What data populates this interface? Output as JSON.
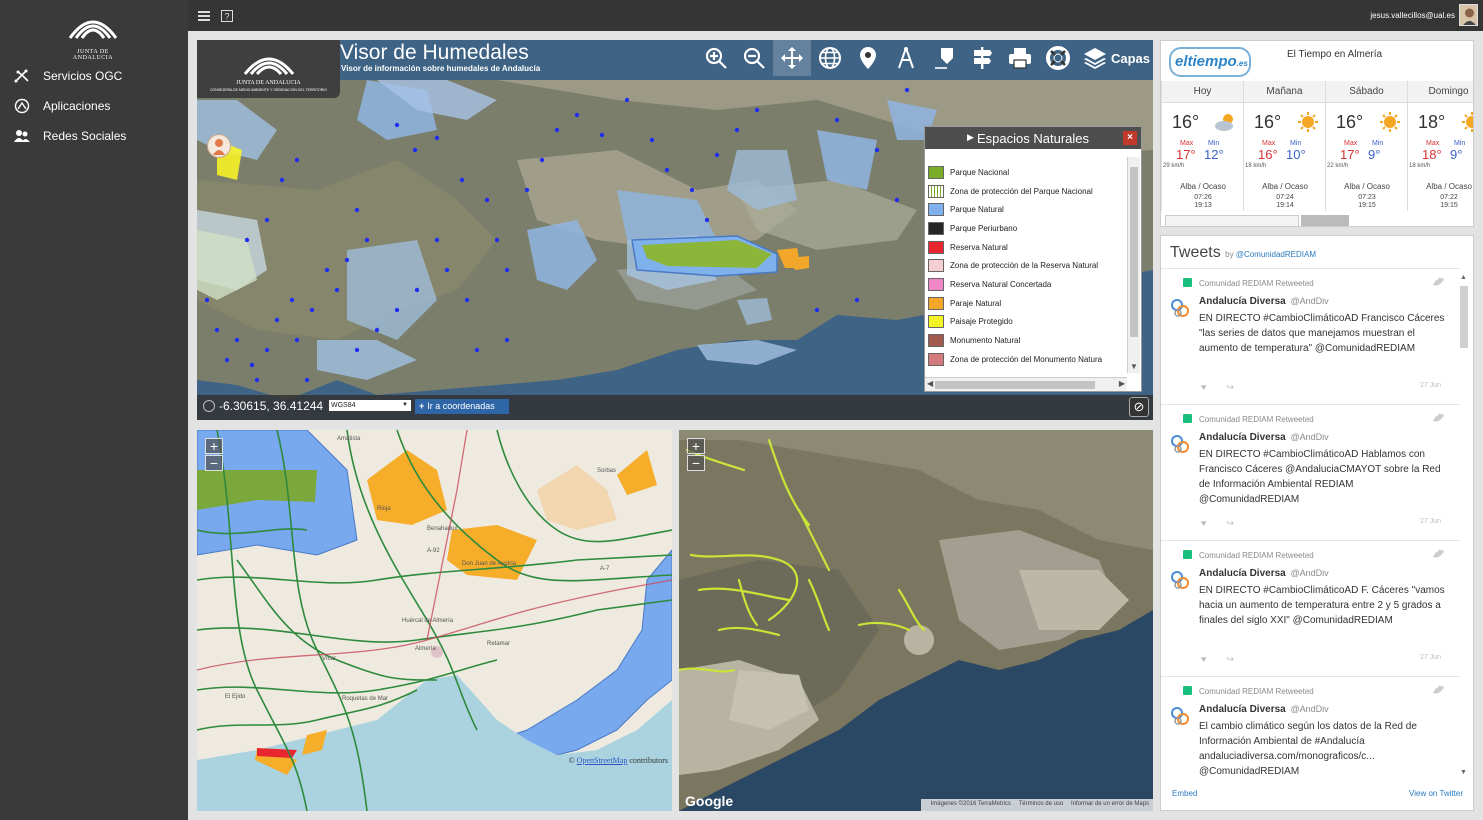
{
  "sidebar": {
    "logo_caption": "JUNTA DE ANDALUCIA",
    "items": [
      {
        "label": "Servicios OGC",
        "icon": "network-icon"
      },
      {
        "label": "Aplicaciones",
        "icon": "apps-icon"
      },
      {
        "label": "Redes Sociales",
        "icon": "people-icon"
      }
    ]
  },
  "topbar": {
    "menu_icon": "menu-icon",
    "help_icon": "help-icon",
    "user_email": "jesus.vallecillos@ual.es"
  },
  "viewer": {
    "logo_caption": "JUNTA DE ANDALUCIA",
    "logo_subcaption": "CONSEJERÍA DE MEDIO AMBIENTE Y ORDENACIÓN DEL TERRITORIO",
    "title": "Visor de Humedales",
    "subtitle": "Visor de información sobre humedales de Andalucía",
    "tools": [
      "zoom-in-icon",
      "zoom-out-icon",
      "pan-icon",
      "globe-icon",
      "location-pin-icon",
      "measure-icon",
      "draw-icon",
      "signpost-icon",
      "print-icon",
      "help-lifebuoy-icon",
      "layers-icon"
    ],
    "active_tool": "pan-icon",
    "capas_label": "Capas",
    "coords": {
      "value": "-6.30615, 36.41244",
      "crs": "WGS84",
      "goto_label": "Ir a coordenadas"
    }
  },
  "legend": {
    "title": "Espacios Naturales",
    "items": [
      {
        "label": "Parque Nacional",
        "color": "#7aac2a"
      },
      {
        "label": "Zona de protección del Parque Nacional",
        "color": "#ffffff"
      },
      {
        "label": "Parque Natural",
        "color": "#7fb2ec"
      },
      {
        "label": "Parque Periurbano",
        "color": "#262626"
      },
      {
        "label": "Reserva Natural",
        "color": "#e8262f"
      },
      {
        "label": "Zona de protección de la Reserva Natural",
        "color": "#f5cfd0"
      },
      {
        "label": "Reserva Natural Concertada",
        "color": "#ef87c6"
      },
      {
        "label": "Paraje Natural",
        "color": "#f2a72a"
      },
      {
        "label": "Paisaje Protegido",
        "color": "#f6f228"
      },
      {
        "label": "Monumento Natural",
        "color": "#a05a4e"
      },
      {
        "label": "Zona de protección del Monumento Natura",
        "color": "#d4797d"
      }
    ]
  },
  "map_osm": {
    "attribution_prefix": "©",
    "attribution_link": "OpenStreetMap",
    "attribution_suffix": "contributors",
    "places": [
      "Amatista",
      "Sorbas",
      "Huércal de Almería",
      "Almería",
      "Vícar",
      "El Ejido",
      "Roquetas de Mar",
      "Don Juan de Austria",
      "Retamar",
      "A-7",
      "A-92",
      "Rioja",
      "Benahadux"
    ]
  },
  "map_google": {
    "logo": "Google",
    "attr_imagery": "Imágenes ©2016 TerraMetrics",
    "attr_terms": "Términos de uso",
    "attr_report": "Informar de un error de Maps"
  },
  "weather": {
    "logo": "eltiempo",
    "logo_suffix": ".es",
    "title": "El Tiempo en Almería",
    "days": [
      {
        "name": "Hoy",
        "temp": "16°",
        "max_label": "Max",
        "max": "17°",
        "min_label": "Min",
        "min": "12°",
        "wind": "29 km/h",
        "sun_label": "Alba / Ocaso",
        "sunrise": "07:26",
        "sunset": "19:13",
        "icon": "cloudy-sun-icon"
      },
      {
        "name": "Mañana",
        "temp": "16°",
        "max_label": "Max",
        "max": "16°",
        "min_label": "Min",
        "min": "10°",
        "wind": "18 km/h",
        "sun_label": "Alba / Ocaso",
        "sunrise": "07:24",
        "sunset": "19:14",
        "icon": "sun-icon"
      },
      {
        "name": "Sábado",
        "temp": "16°",
        "max_label": "Max",
        "max": "17°",
        "min_label": "Min",
        "min": "9°",
        "wind": "22 km/h",
        "sun_label": "Alba / Ocaso",
        "sunrise": "07:23",
        "sunset": "19:15",
        "icon": "sun-icon"
      },
      {
        "name": "Domingo",
        "temp": "18°",
        "max_label": "Max",
        "max": "18°",
        "min_label": "Min",
        "min": "9°",
        "wind": "18 km/h",
        "sun_label": "Alba / Ocaso",
        "sunrise": "07:22",
        "sunset": "19:15",
        "icon": "sun-icon"
      }
    ]
  },
  "tweets": {
    "title": "Tweets",
    "by_prefix": "by",
    "by_account": "@ComunidadREDIAM",
    "items": [
      {
        "retweet": "Comunidad REDIAM Retweeted",
        "name": "Andalucía Diversa",
        "handle": "@AndDiv",
        "text": "EN DIRECTO #CambioClimáticoAD Francisco Cáceres \"las series de datos que manejamos muestran el aumento de temperatura\" @ComunidadREDIAM",
        "date": "27 Jun"
      },
      {
        "retweet": "Comunidad REDIAM Retweeted",
        "name": "Andalucía Diversa",
        "handle": "@AndDiv",
        "text": "EN DIRECTO #CambioClimáticoAD Hablamos con Francisco Cáceres @AndaluciaCMAYOT sobre la Red de Información Ambiental REDIAM @ComunidadREDIAM",
        "date": "27 Jun"
      },
      {
        "retweet": "Comunidad REDIAM Retweeted",
        "name": "Andalucía Diversa",
        "handle": "@AndDiv",
        "text": "EN DIRECTO #CambioClimáticoAD F. Cáceres \"vamos hacia un aumento de temperatura entre 2 y 5 grados a finales del siglo XXI\" @ComunidadREDIAM",
        "date": "27 Jun"
      },
      {
        "retweet": "Comunidad REDIAM Retweeted",
        "name": "Andalucía Diversa",
        "handle": "@AndDiv",
        "text": "El cambio climático según los datos de la Red de Información Ambiental de #Andalucía andaluciadiversa.com/monograficos/c... @ComunidadREDIAM",
        "date": "27 Jun"
      }
    ],
    "embed_label": "Embed",
    "view_label": "View on Twitter"
  }
}
